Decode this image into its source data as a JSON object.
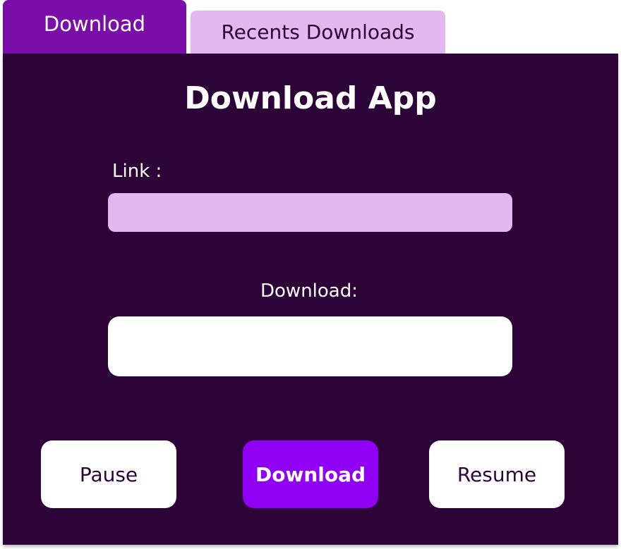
{
  "tabs": {
    "download_label": "Download",
    "recents_label": "Recents Downloads"
  },
  "main": {
    "title": "Download App",
    "link_label": "Link :",
    "link_value": "",
    "download_label": "Download:",
    "download_value": ""
  },
  "buttons": {
    "pause_label": "Pause",
    "download_label": "Download",
    "resume_label": "Resume"
  },
  "colors": {
    "panel_bg": "#2d0438",
    "active_tab": "#7b0ea8",
    "inactive_tab": "#e3b8f1",
    "primary_button": "#8f00f5"
  }
}
